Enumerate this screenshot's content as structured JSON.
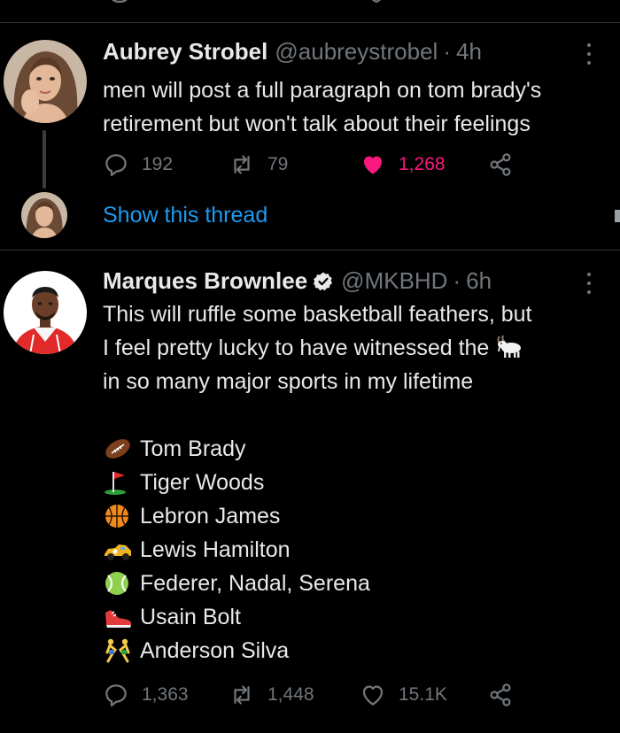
{
  "tweets": [
    {
      "name": "Aubrey Strobel",
      "handle": "@aubreystrobel",
      "separator": "·",
      "time": "4h",
      "text_lines": [
        "men will post a full paragraph on tom brady's",
        "retirement but won't talk about their feelings"
      ],
      "replies": "192",
      "retweets": "79",
      "likes": "1,268",
      "liked": true,
      "show_thread": "Show this thread"
    },
    {
      "name": "Marques Brownlee",
      "handle": "@MKBHD",
      "separator": "·",
      "time": "6h",
      "verified": true,
      "text_lines": [
        "This will ruffle some basketball feathers, but",
        "I feel pretty lucky to have witnessed the",
        "in so many major sports in my lifetime"
      ],
      "inline_emoji": "goat-emoji",
      "sports_list": [
        {
          "emoji": "american-football-emoji",
          "label": "Tom Brady"
        },
        {
          "emoji": "golf-flag-emoji",
          "label": "Tiger Woods"
        },
        {
          "emoji": "basketball-emoji",
          "label": "Lebron James"
        },
        {
          "emoji": "racing-car-emoji",
          "label": "Lewis Hamilton"
        },
        {
          "emoji": "tennis-ball-emoji",
          "label": "Federer, Nadal, Serena"
        },
        {
          "emoji": "running-shoe-emoji",
          "label": "Usain Bolt"
        },
        {
          "emoji": "wrestlers-emoji",
          "label": "Anderson Silva"
        }
      ],
      "replies": "1,363",
      "retweets": "1,448",
      "likes": "15.1K",
      "liked": false
    }
  ],
  "colors": {
    "background": "#000000",
    "text": "#e7e9ea",
    "muted": "#71767b",
    "link": "#1d9bf0",
    "like": "#f91880",
    "divider": "#2f3336"
  }
}
